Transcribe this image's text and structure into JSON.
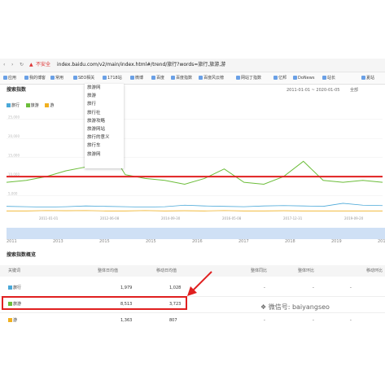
{
  "browser": {
    "security": "不安全",
    "url": "index.baidu.com/v2/main/index.html#/trend/旅行?words=旅行,旅游,游",
    "bookmarks": [
      "应用",
      "我的博客",
      "常用",
      "SEO相关",
      "1718站",
      "微博",
      "百度",
      "百度指数",
      "百度风云榜",
      "网站丁指数",
      "亿邦",
      "DoNews",
      "站长",
      "夏站"
    ]
  },
  "page": {
    "section_title": "搜索指数",
    "date_range": "2011-01-01 ~ 2020-01-05",
    "scope": "全部"
  },
  "dropdown": {
    "items": [
      "旅游网",
      "旅游",
      "旅行",
      "旅行社",
      "旅游攻略",
      "旅游网站",
      "旅行的意义",
      "旅行车",
      "旅游网"
    ]
  },
  "legend": [
    {
      "name": "旅行",
      "color": "#4aa8d8"
    },
    {
      "name": "旅游",
      "color": "#6cbd3a"
    },
    {
      "name": "游",
      "color": "#f0b020"
    }
  ],
  "chart_data": {
    "type": "line",
    "yticks": [
      "25,000",
      "20,000",
      "15,000",
      "10,000",
      "5,000"
    ],
    "xticks": [
      "2011-01-01",
      "2012-06-08",
      "2014-09-30",
      "2016-05-08",
      "2017-12-31",
      "2019-09-20"
    ],
    "series": [
      {
        "name": "旅行",
        "values": [
          2200,
          2100,
          2000,
          2100,
          2300,
          2200,
          2100,
          2000,
          2100,
          2500,
          2300,
          2200,
          2100,
          2300,
          2400,
          2300,
          2200,
          3000,
          2500,
          2400
        ]
      },
      {
        "name": "旅游",
        "values": [
          8500,
          9000,
          10000,
          11500,
          12500,
          19000,
          10500,
          9500,
          9000,
          8000,
          9500,
          12000,
          8500,
          8000,
          10000,
          14000,
          9000,
          8500,
          9000,
          8500
        ]
      },
      {
        "name": "游",
        "values": [
          1000,
          1000,
          1100,
          1050,
          1100,
          1000,
          1000,
          1100,
          1000,
          1050,
          1000,
          1100,
          1000,
          1000,
          1050,
          1000,
          1000,
          1000,
          1000,
          1000
        ]
      }
    ],
    "threshold_line": 10000
  },
  "timeline": {
    "labels": [
      "2011",
      "2013",
      "2015",
      "2015",
      "2016",
      "2017",
      "2018",
      "2019",
      "2018"
    ]
  },
  "overview": {
    "title": "搜索指数概览",
    "headers": [
      "关键词",
      "整体日均值",
      "移动日均值",
      "整体同比",
      "整体环比",
      "移动同比",
      "移动环比"
    ],
    "rows": [
      {
        "keyword": "旅行",
        "color": "#4aa8d8",
        "total": "1,979",
        "mobile": "1,028",
        "a": "-",
        "b": "-",
        "c": "-",
        "d": "-"
      },
      {
        "keyword": "旅游",
        "color": "#6cbd3a",
        "total": "8,513",
        "mobile": "3,723",
        "a": "-",
        "b": "-",
        "c": "-",
        "d": "-"
      },
      {
        "keyword": "游",
        "color": "#f0b020",
        "total": "1,363",
        "mobile": "807",
        "a": "-",
        "b": "-",
        "c": "-",
        "d": "-"
      }
    ]
  },
  "watermark": "微信号: baiyangseo"
}
